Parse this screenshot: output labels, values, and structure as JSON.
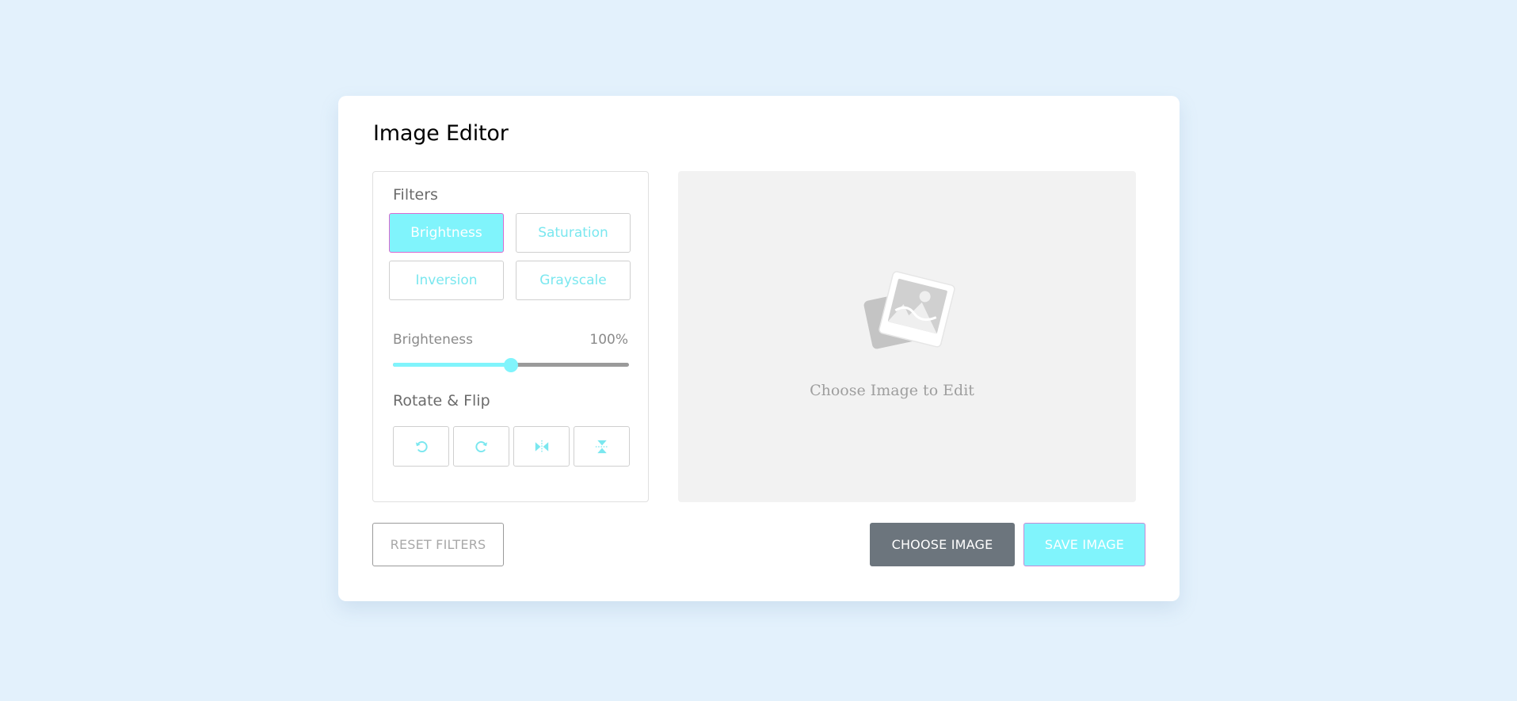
{
  "editor": {
    "title": "Image Editor"
  },
  "filters": {
    "heading": "Filters",
    "buttons": [
      {
        "label": "Brightness",
        "active": true
      },
      {
        "label": "Saturation",
        "active": false
      },
      {
        "label": "Inversion",
        "active": false
      },
      {
        "label": "Grayscale",
        "active": false
      }
    ]
  },
  "slider": {
    "label": "Brighteness",
    "value_text": "100%",
    "level": 0.5
  },
  "rotate": {
    "heading": "Rotate & Flip",
    "icons": [
      "rotate-left-icon",
      "rotate-right-icon",
      "flip-horizontal-icon",
      "flip-vertical-icon"
    ]
  },
  "preview": {
    "placeholder_text": "Choose Image to Edit",
    "icon": "image-placeholder-icon"
  },
  "actions": {
    "reset_label": "RESET FILTERS",
    "choose_label": "CHOOSE IMAGE",
    "save_label": "SAVE IMAGE"
  },
  "colors": {
    "accent": "#80f4fc",
    "background": "#e3f1fc",
    "choose_button": "#6c757d",
    "panel": "#f2f2f2"
  }
}
